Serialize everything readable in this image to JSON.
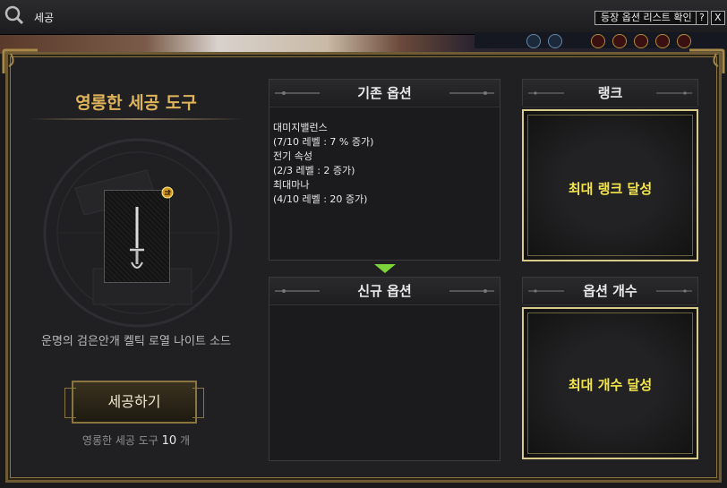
{
  "window": {
    "title": "세공",
    "list_button": "등장 옵션 리스트 확인",
    "help_button": "?",
    "close_button": "X"
  },
  "tool": {
    "title": "영롱한 세공 도구",
    "item_name": "운명의 검은안개 켈틱 로열 나이트 소드",
    "craft_button": "세공하기",
    "count_label": "영롱한 세공 도구",
    "count_value": "10",
    "count_unit": "개"
  },
  "existing_options": {
    "header": "기존 옵션",
    "lines": [
      "대미지밸런스",
      "(7/10 레벨 : 7 % 증가)",
      "전기 속성",
      "(2/3 레벨 : 2 증가)",
      "최대마나",
      "(4/10 레벨 : 20 증가)"
    ]
  },
  "new_options": {
    "header": "신규 옵션"
  },
  "rank": {
    "header": "랭크",
    "status": "최대 랭크 달성"
  },
  "option_count": {
    "header": "옵션 개수",
    "status": "최대 개수 달성"
  },
  "colors": {
    "accent_gold": "#e0b55a",
    "status_yellow": "#f5e64b",
    "frame_gold": "#8a7440",
    "arrow_green": "#7dd33a"
  }
}
